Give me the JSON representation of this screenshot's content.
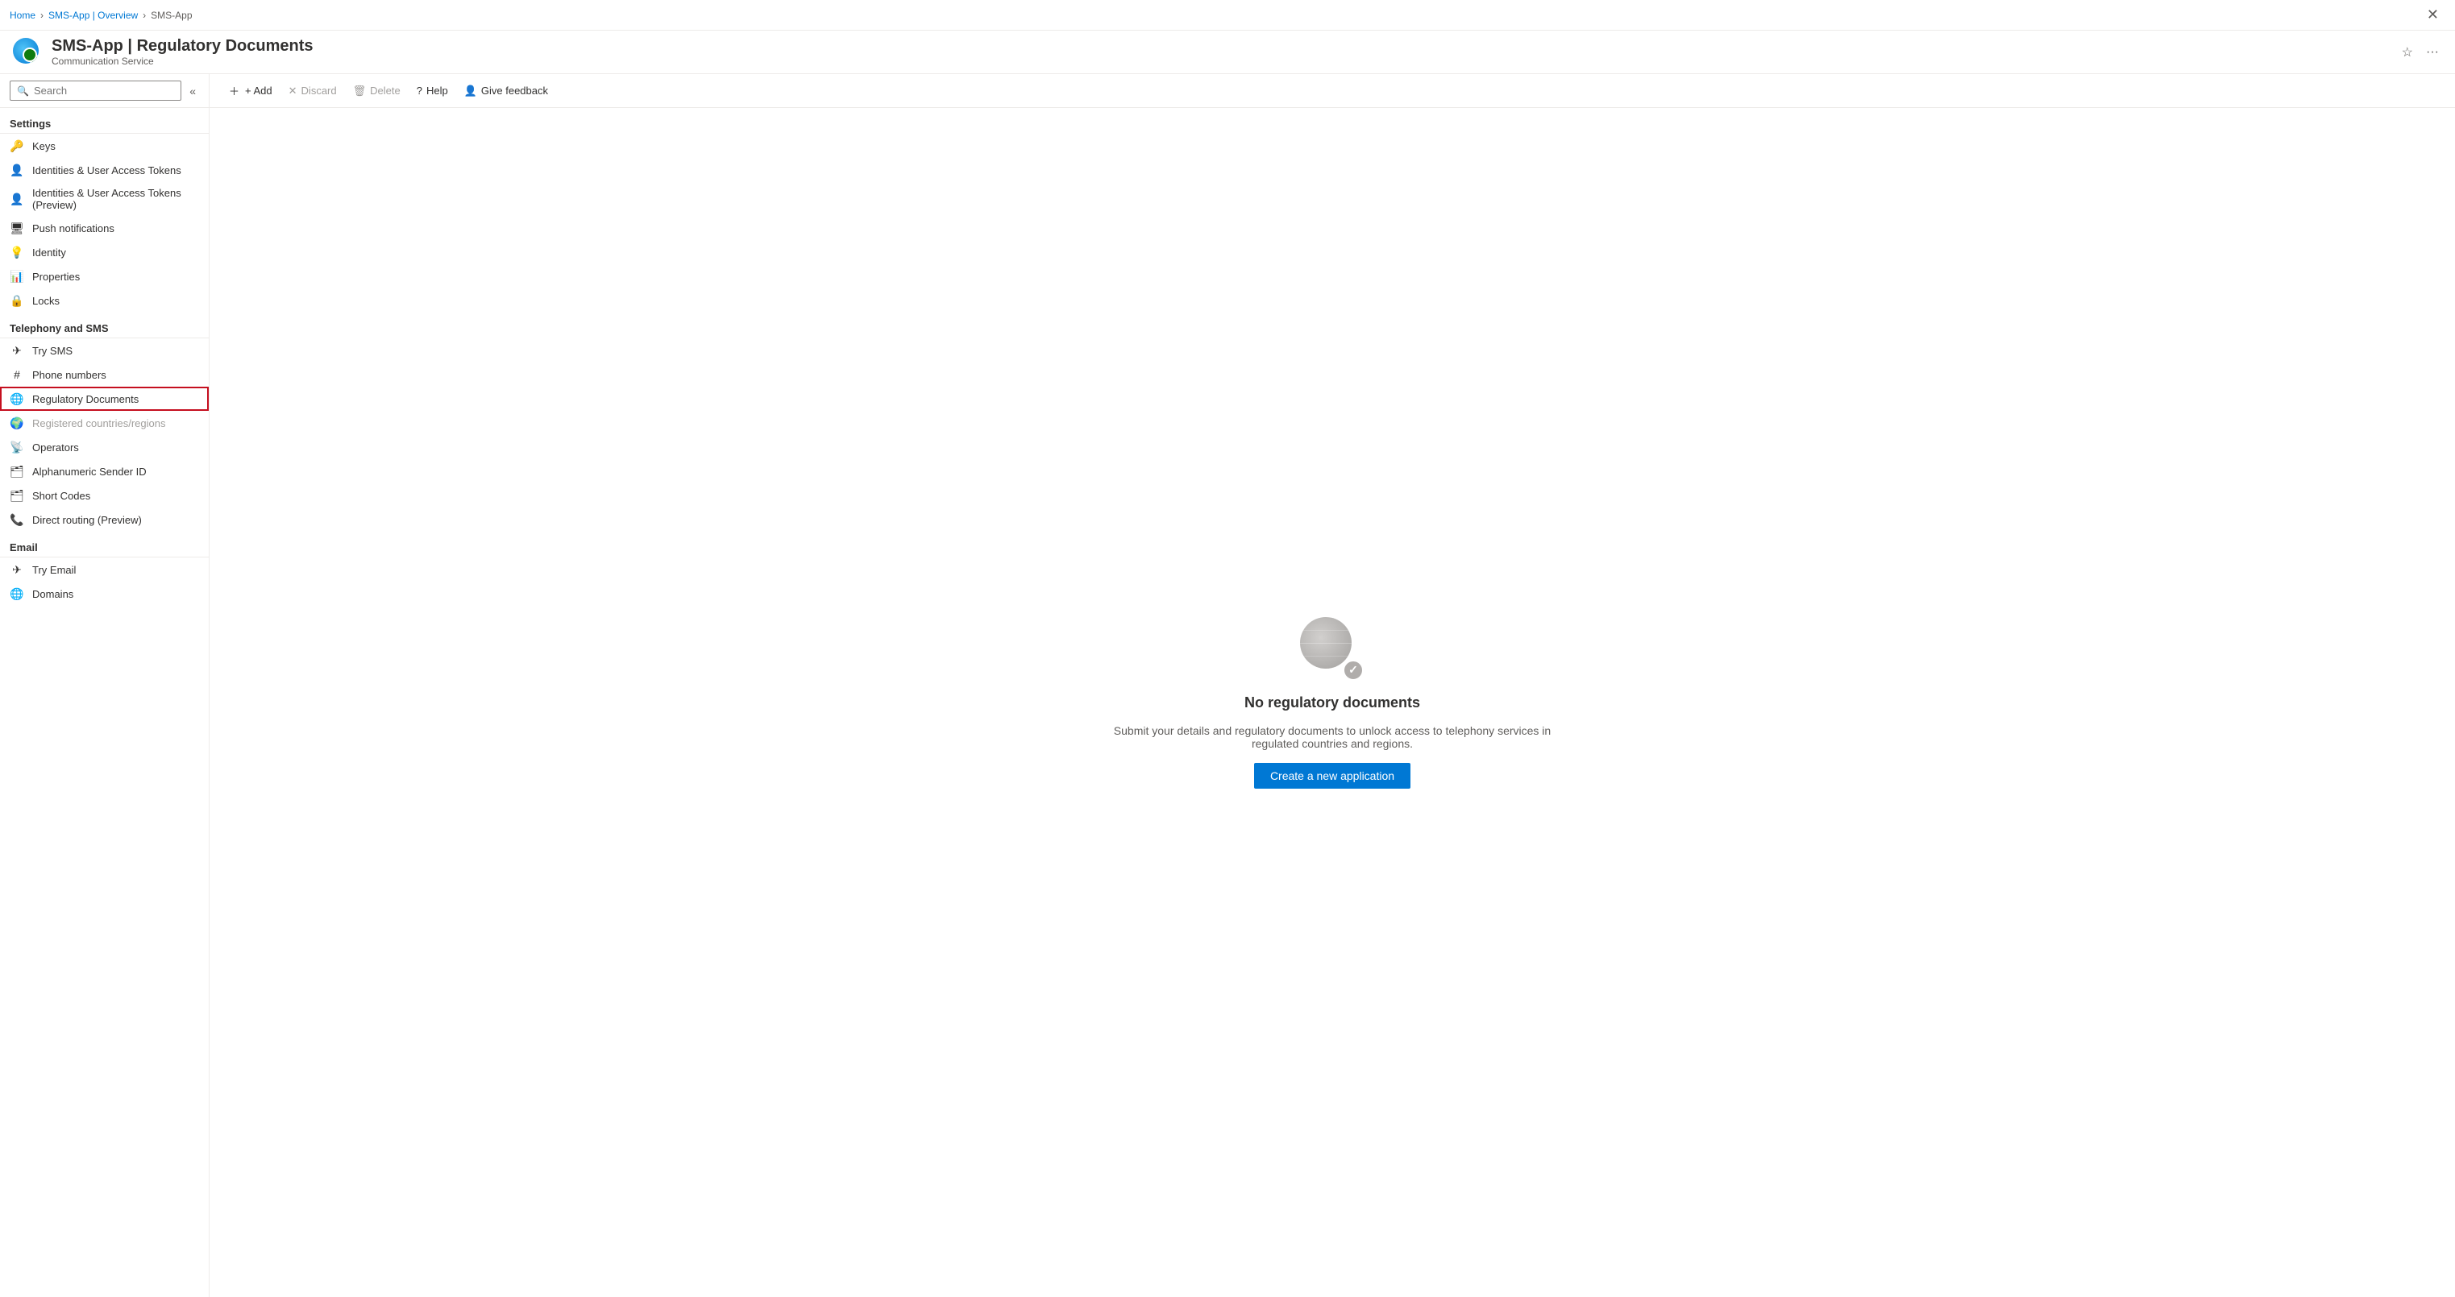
{
  "breadcrumb": {
    "items": [
      {
        "label": "Home",
        "href": "#"
      },
      {
        "label": "SMS-App | Overview",
        "href": "#"
      },
      {
        "label": "SMS-App",
        "href": "#"
      }
    ]
  },
  "resource": {
    "title": "SMS-App | Regulatory Documents",
    "subtitle": "Communication Service",
    "star_label": "★",
    "more_label": "···"
  },
  "sidebar": {
    "search_placeholder": "Search",
    "collapse_label": "«",
    "sections": [
      {
        "label": "Settings",
        "items": [
          {
            "id": "keys",
            "label": "Keys",
            "icon": "🔑"
          },
          {
            "id": "identities",
            "label": "Identities & User Access Tokens",
            "icon": "👤"
          },
          {
            "id": "identities-preview",
            "label": "Identities & User Access Tokens (Preview)",
            "icon": "👤"
          },
          {
            "id": "push-notifications",
            "label": "Push notifications",
            "icon": "🖥"
          },
          {
            "id": "identity",
            "label": "Identity",
            "icon": "💡"
          },
          {
            "id": "properties",
            "label": "Properties",
            "icon": "📊"
          },
          {
            "id": "locks",
            "label": "Locks",
            "icon": "🔒"
          }
        ]
      },
      {
        "label": "Telephony and SMS",
        "items": [
          {
            "id": "try-sms",
            "label": "Try SMS",
            "icon": "✈"
          },
          {
            "id": "phone-numbers",
            "label": "Phone numbers",
            "icon": "#"
          },
          {
            "id": "regulatory-documents",
            "label": "Regulatory Documents",
            "icon": "🌐",
            "active": true
          },
          {
            "id": "registered-countries",
            "label": "Registered countries/regions",
            "icon": "🌍",
            "disabled": true
          },
          {
            "id": "operators",
            "label": "Operators",
            "icon": "📡"
          },
          {
            "id": "alphanumeric-sender-id",
            "label": "Alphanumeric Sender ID",
            "icon": "🗂"
          },
          {
            "id": "short-codes",
            "label": "Short Codes",
            "icon": "🗂"
          },
          {
            "id": "direct-routing",
            "label": "Direct routing (Preview)",
            "icon": "📞"
          }
        ]
      },
      {
        "label": "Email",
        "items": [
          {
            "id": "try-email",
            "label": "Try Email",
            "icon": "✈"
          },
          {
            "id": "domains",
            "label": "Domains",
            "icon": "🌐"
          }
        ]
      }
    ]
  },
  "toolbar": {
    "add_label": "+ Add",
    "discard_label": "✕ Discard",
    "delete_label": "🗑 Delete",
    "help_label": "? Help",
    "feedback_label": "Give feedback"
  },
  "content": {
    "empty_title": "No regulatory documents",
    "empty_desc": "Submit your details and regulatory documents to unlock access to telephony services in regulated countries and regions.",
    "create_btn_label": "Create a new application"
  }
}
